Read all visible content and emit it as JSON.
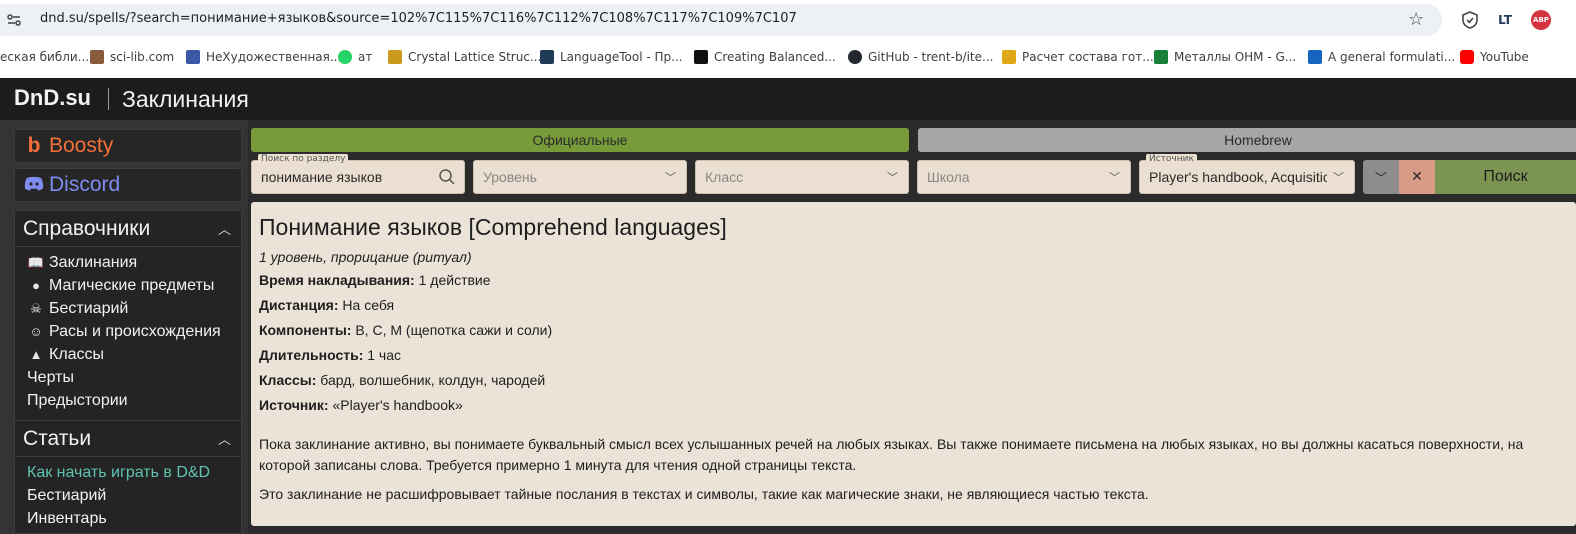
{
  "browser": {
    "url": "dnd.su/spells/?search=понимание+языков&source=102%7C115%7C116%7C112%7C108%7C117%7C109%7C107",
    "ext_lt_label": "LT",
    "ext_abp_label": "ABP",
    "bookmarks": [
      {
        "label": "еская библи...",
        "color": "#6b4f2a"
      },
      {
        "label": "sci-lib.com",
        "color": "#8a5a3c"
      },
      {
        "label": "НеХудожественная...",
        "color": "#3b57a5"
      },
      {
        "label": "ат",
        "color": "#25d366"
      },
      {
        "label": "Crystal Lattice Struc...",
        "color": "#c99a1c"
      },
      {
        "label": "LanguageTool - Пр...",
        "color": "#1f3b57"
      },
      {
        "label": "Creating Balanced...",
        "color": "#111111"
      },
      {
        "label": "GitHub - trent-b/ite...",
        "color": "#24292f"
      },
      {
        "label": "Расчет состава гот...",
        "color": "#e0a818"
      },
      {
        "label": "Металлы ОНМ - G...",
        "color": "#188038"
      },
      {
        "label": "A general formulati...",
        "color": "#1565c0"
      },
      {
        "label": "YouTube",
        "color": "#ff0000"
      }
    ]
  },
  "header": {
    "logo": "DnD.su",
    "title": "Заклинания"
  },
  "sidebar": {
    "boosty": "Boosty",
    "discord": "Discord",
    "reference": {
      "title": "Справочники",
      "items": [
        {
          "label": "Заклинания",
          "icon": "book-icon",
          "glyph": "📖"
        },
        {
          "label": "Магические предметы",
          "icon": "orb-icon",
          "glyph": "●"
        },
        {
          "label": "Бестиарий",
          "icon": "skull-icon",
          "glyph": "☠"
        },
        {
          "label": "Расы и происхождения",
          "icon": "person-icon",
          "glyph": "☺"
        },
        {
          "label": "Классы",
          "icon": "helmet-icon",
          "glyph": "▲"
        },
        {
          "label": "Черты",
          "icon": "",
          "glyph": ""
        },
        {
          "label": "Предыстории",
          "icon": "",
          "glyph": ""
        }
      ]
    },
    "articles": {
      "title": "Статьи",
      "items": [
        "Как начать играть в D&D",
        "Бестиарий",
        "Инвентарь"
      ]
    }
  },
  "filters": {
    "tab_official": "Официальные",
    "tab_homebrew": "Homebrew",
    "search_label": "Поиск по разделу",
    "search_value": "понимание языков",
    "level_placeholder": "Уровень",
    "class_placeholder": "Класс",
    "school_placeholder": "Школа",
    "source_label": "Источник",
    "source_value": "Player's handbook, Acquisitions",
    "clear_glyph": "✕",
    "search_button": "Поиск"
  },
  "spell": {
    "title": "Понимание языков [Comprehend languages]",
    "meta": "1 уровень, прорицание (ритуал)",
    "props": [
      {
        "key": "Время накладывания:",
        "value": " 1 действие"
      },
      {
        "key": "Дистанция:",
        "value": " На себя"
      },
      {
        "key": "Компоненты:",
        "value": " В, С, М (щепотка сажи и соли)"
      },
      {
        "key": "Длительность:",
        "value": " 1 час"
      },
      {
        "key": "Классы:",
        "value": " бард, волшебник, колдун, чародей"
      },
      {
        "key": "Источник:",
        "value": " «Player's handbook»"
      }
    ],
    "desc1": "Пока заклинание активно, вы понимаете буквальный смысл всех услышанных речей на любых языках. Вы также понимаете письмена на любых языках, но вы должны касаться поверхности, на которой записаны слова. Требуется примерно 1 минута для чтения одной страницы текста.",
    "desc2": "Это заклинание не расшифровывает тайные послания в текстах и символы, такие как магические знаки, не являющиеся частью текста."
  }
}
